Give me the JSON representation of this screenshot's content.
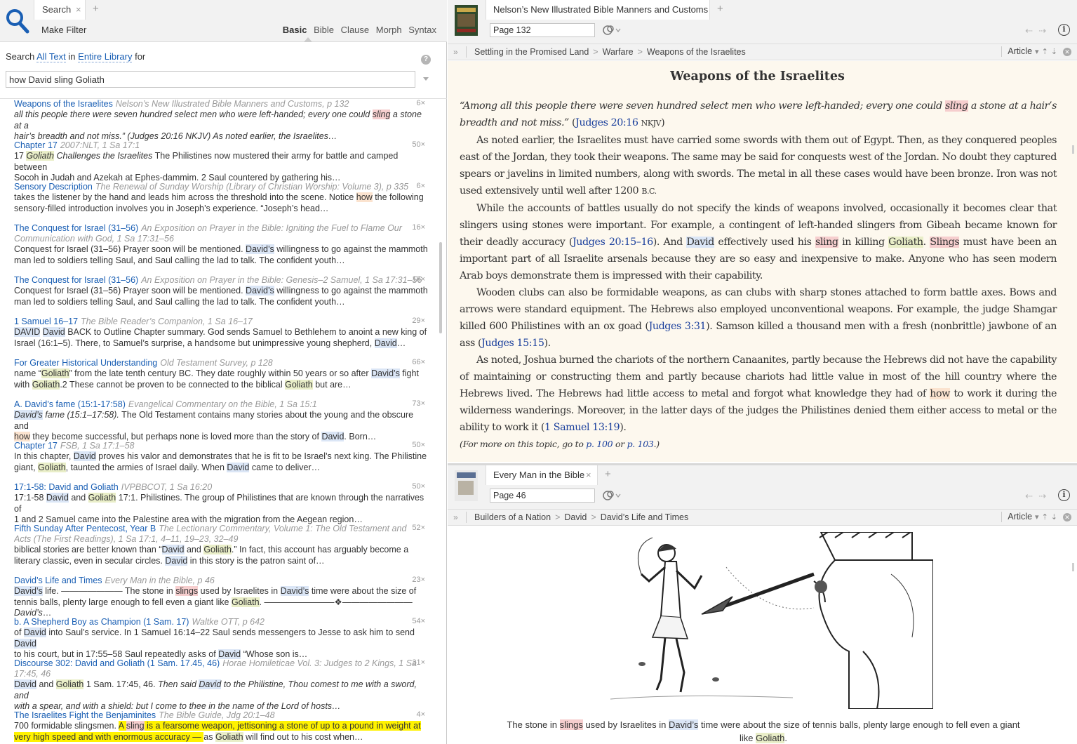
{
  "search_panel": {
    "tab_label": "Search",
    "tab_close": "×",
    "tab_add": "+",
    "make_filter": "Make Filter",
    "kinds": [
      "Basic",
      "Bible",
      "Clause",
      "Morph",
      "Syntax"
    ],
    "active_kind": "Basic",
    "row_prefix": "Search",
    "scope_field": "All Text",
    "row_in": "in",
    "scope_library": "Entire Library",
    "row_for": "for",
    "help": "?",
    "query": "how David sling Goliath"
  },
  "results": [
    {
      "title": "Weapons of the Israelites",
      "source": "Nelson’s New Illustrated Bible Manners and Customs, p 132",
      "count": "6×"
    },
    {
      "title": "Chapter 17",
      "source": "2007:NLT, 1 Sa 17:1",
      "count": "50×"
    },
    {
      "title": "Sensory Description",
      "source": "The Renewal of Sunday Worship (Library of Christian Worship: Volume 3), p 335",
      "count": "6×"
    },
    {
      "title": "The Conquest for Israel (31–56)",
      "source": "An Exposition on Prayer in the Bible: Igniting the Fuel to Flame Our",
      "count": "16×"
    },
    {
      "title": "The Conquest for Israel (31–56)",
      "source": "An Exposition on Prayer in the Bible: Genesis–2 Samuel, 1 Sa 17:31–56",
      "count": "16×"
    },
    {
      "title": "1 Samuel 16–17",
      "source": "The Bible Reader’s Companion, 1 Sa 16–17",
      "count": "29×"
    },
    {
      "title": "For Greater Historical Understanding",
      "source": "Old Testament Survey, p 128",
      "count": "66×"
    },
    {
      "title": "A. David’s fame (15:1-17:58)",
      "source": "Evangelical Commentary on the Bible, 1 Sa 15:1",
      "count": "73×"
    },
    {
      "title": "Chapter 17",
      "source": "FSB, 1 Sa 17:1–58",
      "count": "50×"
    },
    {
      "title": "17:1-58: David and Goliath",
      "source": "IVPBBCOT, 1 Sa 16:20",
      "count": "50×"
    },
    {
      "title": "Fifth Sunday After Pentecost, Year B",
      "source": "The Lectionary Commentary, Volume 1: The Old Testament and",
      "count": "52×"
    },
    {
      "title": "David’s Life and Times",
      "source": "Every Man in the Bible, p 46",
      "count": "23×"
    },
    {
      "title": "b. A Shepherd Boy as Champion (1 Sam. 17)",
      "source": "Waltke OTT, p 642",
      "count": "54×"
    },
    {
      "title": "Discourse 302: David and Goliath (1 Sam. 17.45, 46)",
      "source": "Horae Homileticae Vol. 3: Judges to 2 Kings, 1 Sa",
      "count": "31×"
    },
    {
      "title": "The Israelites Fight the Benjaminites",
      "source": "The Bible Guide, Jdg 20:1–48",
      "count": "4×"
    }
  ],
  "result_extra": {
    "r3_src2": "Communication with God, 1 Sa 17:31–56",
    "r10_src2": "Acts (The First Readings), 1 Sa 17:1, 4–11, 19–23, 32–49",
    "r13_src2": "17:45, 46"
  },
  "snippets": {
    "s0a": "all this people there were seven hundred select men who were left-handed; every one could ",
    "s0b": "sling",
    "s0c": " a stone at a",
    "s0d": "hair’s breadth and not miss.” (Judges 20:16 NKJV) As noted earlier, the Israelites…",
    "s1a": "17 ",
    "s1b": "Goliath",
    "s1c": " Challenges the Israelites",
    "s1d": " The Philistines now mustered their army for battle and camped between",
    "s1e": "Socoh in Judah and Azekah at Ephes-dammim. 2 Saul countered by gathering his…",
    "s2a": "takes the listener by the hand and leads him across the threshold into the scene. Notice ",
    "s2b": "how",
    "s2c": " the following",
    "s2d": "sensory-filled introduction involves you in Joseph’s experience. “Joseph’s head…",
    "s3a": "Conquest for Israel (31–56) Prayer soon will be mentioned. ",
    "s3b": "David’s",
    "s3c": " willingness to go against the mammoth",
    "s3d": "man led to soldiers telling Saul, and Saul calling the lad to talk. The confident youth…",
    "s5a": "DAVID",
    "s5b": "David",
    "s5c": " BACK to Outline Chapter summary. God sends Samuel to Bethlehem to anoint a new king of",
    "s5d": "Israel (16:1–5). There, to Samuel’s surprise, a handsome but unimpressive young shepherd, ",
    "s5e": "David",
    "s5f": "…",
    "s6a": "name “",
    "s6b": "Goliath",
    "s6c": "” from the late tenth century BC. They date roughly within 50 years or so after ",
    "s6d": "David’s",
    "s6e": " fight",
    "s6f": "with ",
    "s6g": "Goliath",
    "s6h": ".2 These cannot be proven to be connected to the biblical ",
    "s6i": "Goliath",
    "s6j": " but are…",
    "s7a": "David’s",
    "s7b": " fame (15:1–17:58).",
    "s7c": " The Old Testament contains many stories about the young and the obscure and",
    "s7d": "how",
    "s7e": " they become successful, but perhaps none is loved more than the story of ",
    "s7f": "David",
    "s7g": ". Born…",
    "s8a": "In this chapter, ",
    "s8b": "David",
    "s8c": " proves his valor and demonstrates that he is fit to be Israel’s next king. The Philistine",
    "s8d": "giant, ",
    "s8e": "Goliath",
    "s8f": ", taunted the armies of Israel daily. When ",
    "s8g": "David",
    "s8h": " came to deliver…",
    "s9a": "17:1-58 ",
    "s9b": "David",
    "s9c": " and ",
    "s9d": "Goliath",
    "s9e": " 17:1. Philistines. The group of Philistines that are known through the narratives of",
    "s9f": "1 and 2 Samuel came into the Palestine area with the migration from the Aegean region…",
    "s10a": "biblical stories are better known than “",
    "s10b": "David",
    "s10c": " and ",
    "s10d": "Goliath",
    "s10e": ".” In fact, this account has arguably become a",
    "s10f": "literary classic, even in secular circles. ",
    "s10g": "David",
    "s10h": " in this story is the patron saint of…",
    "s11a": "David’s",
    "s11b": " life. ——————— The stone in ",
    "s11c": "slings",
    "s11d": " used by Israelites in ",
    "s11e": "David’s",
    "s11f": " time were about the size of",
    "s11g": "tennis balls, plenty large enough to fell even a giant like ",
    "s11h": "Goliath",
    "s11i": ". ————————❖———————— ",
    "s11j": "David’s",
    "s11k": "…",
    "s12a": "of ",
    "s12b": "David",
    "s12c": " into Saul’s service. In 1 Samuel 16:14–22 Saul sends messengers to Jesse to ask him to send ",
    "s12d": "David",
    "s12e": "to his court, but in 17:55–58 Saul repeatedly asks of ",
    "s12f": "David",
    "s12g": " “Whose son is…",
    "s13a": "David",
    "s13b": " and ",
    "s13c": "Goliath",
    "s13d": " 1 Sam. 17:45, 46. ",
    "s13e": "Then said ",
    "s13f": "David",
    "s13g": " to the Philistine, Thou comest to me with a sword, and",
    "s13h": "with a spear, and with a shield: but I come to thee in the name of the Lord of hosts…",
    "s14a": "700 formidable slingsmen. ",
    "s14b": "A ",
    "s14c": "sling",
    "s14d": " is a fearsome weapon, jettisoning a stone of up to a pound in weight at",
    "s14e": "very high speed and with enormous accuracy — ",
    "s14f": "as ",
    "s14g": "Goliath",
    "s14h": " will find out to his cost when…"
  },
  "top_panel": {
    "tab_title": "Nelson’s New Illustrated Bible Manners and Customs",
    "tab_add": "+",
    "page": "Page 132",
    "breadcrumb": [
      "Settling in the Promised Land",
      "Warfare",
      "Weapons of the Israelites"
    ],
    "view": "Article",
    "heading": "Weapons of the Israelites",
    "p0a": "“Among all this people there were seven hundred select men who were left-handed; every one could ",
    "p0b": "sling",
    "p0c": " a stone at a hair’s breadth and not miss.”",
    "p0ref": "Judges 20:16",
    "p0ver": "NKJV",
    "p1": "As noted earlier, the Israelites must have carried some swords with them out of Egypt. Then, as they conquered peoples east of the Jordan, they took their weapons. The same may be said for conquests west of the Jordan. No doubt they captured spears or javelins in limited numbers, along with swords. The metal in all these cases would have been bronze. Iron was not used extensively until well after 1200 ",
    "p1sc": "B.C.",
    "p2a": "While the accounts of battles usually do not specify the kinds of weapons involved, occasionally it becomes clear that slingers using stones were important. For example, a contingent of left-handed slingers from Gibeah became known for their deadly accuracy (",
    "p2ref": "Judges 20:15–16",
    "p2b": "). And ",
    "p2c": "David",
    "p2d": " effectively used his ",
    "p2e": "sling",
    "p2f": " in killing ",
    "p2g": "Goliath",
    "p2h": ". ",
    "p2i": "Slings",
    "p2j": " must have been an important part of all Israelite arsenals because they are so easy and inexpensive to make. Anyone who has seen modern Arab boys demonstrate them is impressed with their capability.",
    "p3a": "Wooden clubs can also be formidable weapons, as can clubs with sharp stones attached to form battle axes. Bows and arrows were standard equipment. The Hebrews also employed unconventional weapons. For example, the judge Shamgar killed 600 Philistines with an ox goad (",
    "p3ref1": "Judges 3:31",
    "p3b": "). Samson killed a thousand men with a fresh (nonbrittle) jawbone of an ass (",
    "p3ref2": "Judges 15:15",
    "p3c": ").",
    "p4a": "As noted, Joshua burned the chariots of the northern Canaanites, partly because the Hebrews did not have the capability of maintaining or constructing them and partly because chariots had little value in most of the hill country where the Hebrews lived. The Hebrews had little access to metal and forgot what knowledge they had of ",
    "p4b": "how",
    "p4c": " to work it during the wilderness wanderings. Moreover, in the latter days of the judges the Philistines denied them either access to metal or the ability to work it (",
    "p4ref": "1 Samuel 13:19",
    "p4d": ").",
    "more_a": "(For more on this topic, go to ",
    "more_p1": "p. 100",
    "more_or": " or ",
    "more_p2": "p. 103",
    "more_b": ".)"
  },
  "bottom_panel": {
    "tab_title": "Every Man in the Bible",
    "tab_close": "×",
    "tab_add": "+",
    "page": "Page 46",
    "breadcrumb": [
      "Builders of a Nation",
      "David",
      "David’s Life and Times"
    ],
    "view": "Article",
    "cap_a": "The stone in ",
    "cap_b": "slings",
    "cap_c": " used by Israelites in ",
    "cap_d": "David’s",
    "cap_e": " time were about the size of tennis balls, plenty large enough to fell even a giant",
    "cap_f": "like ",
    "cap_g": "Goliath",
    "cap_h": "."
  },
  "colors": {
    "link": "#1a5fb4",
    "article_bg": "#fdf8ee",
    "hl_sling": "#f6cece",
    "hl_david": "#dbe6f6",
    "hl_goliath": "#e9eec8",
    "hl_how": "#fbe3cf",
    "hl_yellow": "#fff200"
  }
}
